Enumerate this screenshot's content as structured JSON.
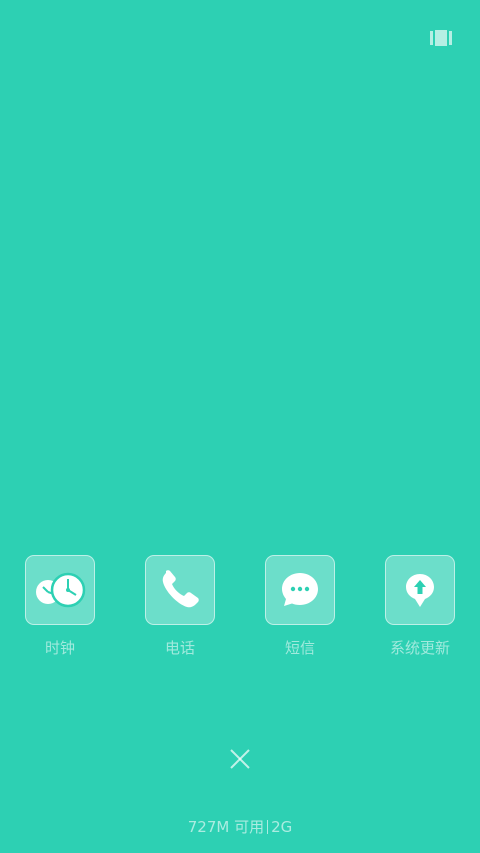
{
  "top_bar": {
    "view_toggle_icon": "recent-apps-grid-icon"
  },
  "apps": [
    {
      "label": "时钟",
      "icon": "clock-icon"
    },
    {
      "label": "电话",
      "icon": "phone-icon"
    },
    {
      "label": "短信",
      "icon": "message-icon"
    },
    {
      "label": "系统更新",
      "icon": "system-update-icon"
    }
  ],
  "close_button": {
    "icon": "close-icon"
  },
  "memory": {
    "available": "727M 可用",
    "total": "2G"
  },
  "colors": {
    "background": "#2dd0b3",
    "foreground": "#ffffff"
  }
}
